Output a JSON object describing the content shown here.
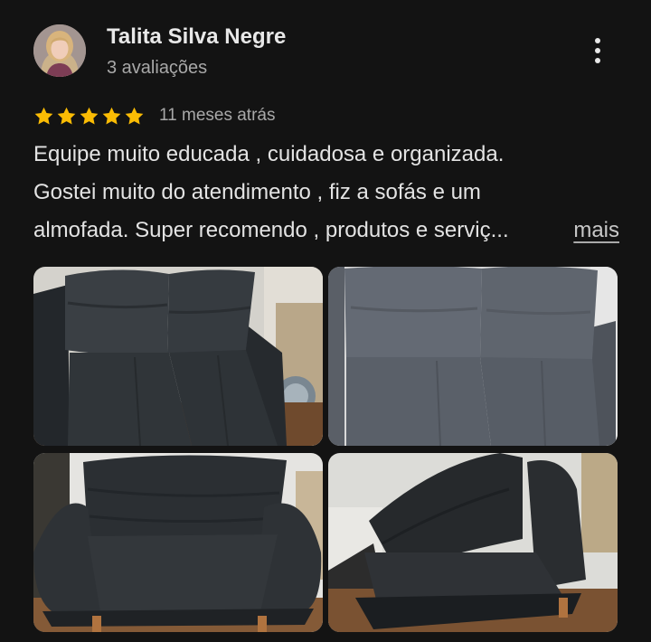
{
  "reviewer": {
    "name": "Talita Silva Negre",
    "reviews_count": "3 avaliações"
  },
  "rating": {
    "stars": 5,
    "max": 5,
    "star_color": "#fbbc04",
    "date": "11 meses atrás"
  },
  "review": {
    "lines": [
      "Equipe muito educada , cuidadosa e organizada.",
      "Gostei muito do atendimento , fiz a sofás e um",
      "almofada. Super recomendo , produtos e serviç..."
    ],
    "more_label": "mais"
  },
  "icons": {
    "menu": "more-vert-icon",
    "star": "star-icon"
  },
  "colors": {
    "background": "#131313",
    "text": "#e3e3e3",
    "muted": "#a8a8a8"
  }
}
